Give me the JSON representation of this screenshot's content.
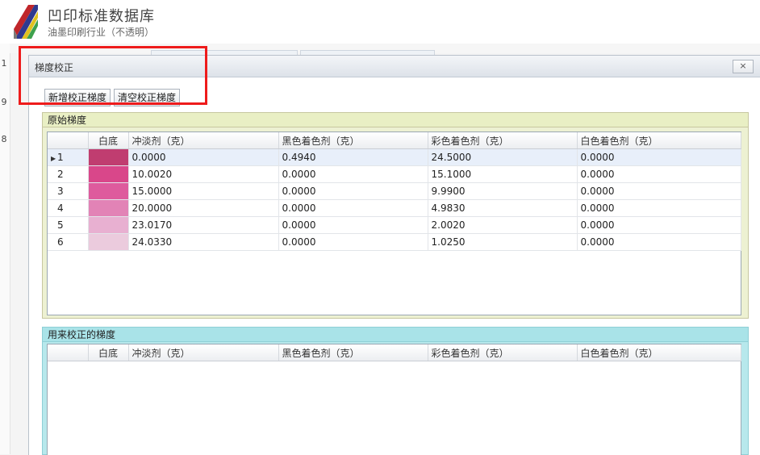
{
  "app": {
    "title": "凹印标准数据库",
    "subtitle": "油墨印刷行业（不透明）"
  },
  "background": {
    "row_numbers": [
      "1",
      "9",
      "8"
    ]
  },
  "dialog": {
    "title": "梯度校正",
    "close_label": "×",
    "toolbar": {
      "add_label": "新增校正梯度",
      "clear_label": "清空校正梯度"
    },
    "original": {
      "title": "原始梯度",
      "columns": [
        "",
        "白底",
        "冲淡剂（克）",
        "黑色着色剂（克）",
        "彩色着色剂（克）",
        "白色着色剂（克）"
      ],
      "rows": [
        {
          "no": "1",
          "swatch": "#c03d70",
          "diluent": "0.0000",
          "black": "0.4940",
          "color": "24.5000",
          "white": "0.0000"
        },
        {
          "no": "2",
          "swatch": "#d9478a",
          "diluent": "10.0020",
          "black": "0.0000",
          "color": "15.1000",
          "white": "0.0000"
        },
        {
          "no": "3",
          "swatch": "#de5b9d",
          "diluent": "15.0000",
          "black": "0.0000",
          "color": "9.9900",
          "white": "0.0000"
        },
        {
          "no": "4",
          "swatch": "#e283b6",
          "diluent": "20.0000",
          "black": "0.0000",
          "color": "4.9830",
          "white": "0.0000"
        },
        {
          "no": "5",
          "swatch": "#e8b0d1",
          "diluent": "23.0170",
          "black": "0.0000",
          "color": "2.0020",
          "white": "0.0000"
        },
        {
          "no": "6",
          "swatch": "#ebcbdd",
          "diluent": "24.0330",
          "black": "0.0000",
          "color": "1.0250",
          "white": "0.0000"
        }
      ]
    },
    "correction": {
      "title": "用来校正的梯度",
      "columns": [
        "",
        "白底",
        "冲淡剂（克）",
        "黑色着色剂（克）",
        "彩色着色剂（克）",
        "白色着色剂（克）"
      ]
    }
  }
}
